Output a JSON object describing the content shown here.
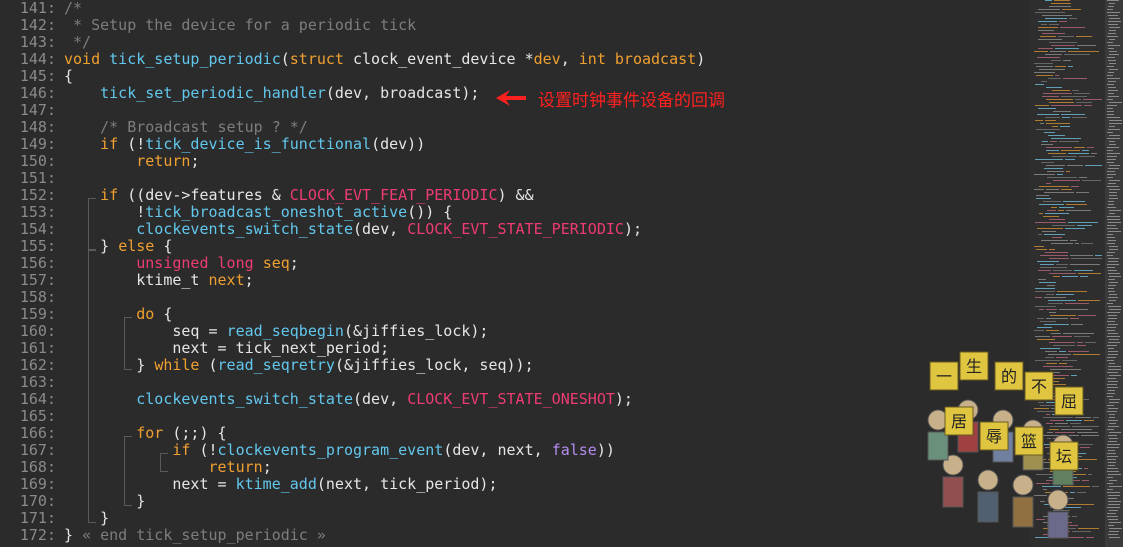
{
  "editor": {
    "lines": [
      {
        "n": "141:",
        "tokens": [
          [
            "cmt",
            "/*"
          ]
        ]
      },
      {
        "n": "142:",
        "tokens": [
          [
            "cmt",
            " * Setup the device for a periodic tick"
          ]
        ]
      },
      {
        "n": "143:",
        "tokens": [
          [
            "cmt",
            " */"
          ]
        ]
      },
      {
        "n": "144:",
        "tokens": [
          [
            "kw",
            "void"
          ],
          [
            "plain",
            " "
          ],
          [
            "fn",
            "tick_setup_periodic"
          ],
          [
            "plain",
            "("
          ],
          [
            "kw",
            "struct"
          ],
          [
            "plain",
            " clock_event_device *"
          ],
          [
            "param",
            "dev"
          ],
          [
            "plain",
            ", "
          ],
          [
            "kw",
            "int"
          ],
          [
            "plain",
            " "
          ],
          [
            "param",
            "broadcast"
          ],
          [
            "plain",
            ")"
          ]
        ]
      },
      {
        "n": "145:",
        "tokens": [
          [
            "plain",
            "{"
          ]
        ]
      },
      {
        "n": "146:",
        "tokens": [
          [
            "plain",
            "    "
          ],
          [
            "fn",
            "tick_set_periodic_handler"
          ],
          [
            "plain",
            "(dev, broadcast);"
          ]
        ]
      },
      {
        "n": "147:",
        "tokens": []
      },
      {
        "n": "148:",
        "tokens": [
          [
            "plain",
            "    "
          ],
          [
            "cmt",
            "/* Broadcast setup ? */"
          ]
        ]
      },
      {
        "n": "149:",
        "tokens": [
          [
            "plain",
            "    "
          ],
          [
            "kw",
            "if"
          ],
          [
            "plain",
            " (!"
          ],
          [
            "fn",
            "tick_device_is_functional"
          ],
          [
            "plain",
            "(dev))"
          ]
        ]
      },
      {
        "n": "150:",
        "tokens": [
          [
            "plain",
            "        "
          ],
          [
            "kw",
            "return"
          ],
          [
            "plain",
            ";"
          ]
        ]
      },
      {
        "n": "151:",
        "tokens": []
      },
      {
        "n": "152:",
        "tokens": [
          [
            "plain",
            "    "
          ],
          [
            "kw",
            "if"
          ],
          [
            "plain",
            " ((dev->features & "
          ],
          [
            "const",
            "CLOCK_EVT_FEAT_PERIODIC"
          ],
          [
            "plain",
            ") &&"
          ]
        ]
      },
      {
        "n": "153:",
        "tokens": [
          [
            "plain",
            "        !"
          ],
          [
            "fn",
            "tick_broadcast_oneshot_active"
          ],
          [
            "plain",
            "()) {"
          ]
        ]
      },
      {
        "n": "154:",
        "tokens": [
          [
            "plain",
            "        "
          ],
          [
            "fn",
            "clockevents_switch_state"
          ],
          [
            "plain",
            "(dev, "
          ],
          [
            "const",
            "CLOCK_EVT_STATE_PERIODIC"
          ],
          [
            "plain",
            ");"
          ]
        ]
      },
      {
        "n": "155:",
        "tokens": [
          [
            "plain",
            "    } "
          ],
          [
            "kw",
            "else"
          ],
          [
            "plain",
            " {"
          ]
        ]
      },
      {
        "n": "156:",
        "tokens": [
          [
            "plain",
            "        "
          ],
          [
            "const",
            "unsigned long"
          ],
          [
            "plain",
            " "
          ],
          [
            "kw",
            "seq"
          ],
          [
            "plain",
            ";"
          ]
        ]
      },
      {
        "n": "157:",
        "tokens": [
          [
            "plain",
            "        ktime_t "
          ],
          [
            "kw",
            "next"
          ],
          [
            "plain",
            ";"
          ]
        ]
      },
      {
        "n": "158:",
        "tokens": []
      },
      {
        "n": "159:",
        "tokens": [
          [
            "plain",
            "        "
          ],
          [
            "kw",
            "do"
          ],
          [
            "plain",
            " {"
          ]
        ]
      },
      {
        "n": "160:",
        "tokens": [
          [
            "plain",
            "            seq = "
          ],
          [
            "fn",
            "read_seqbegin"
          ],
          [
            "plain",
            "(&jiffies_lock);"
          ]
        ]
      },
      {
        "n": "161:",
        "tokens": [
          [
            "plain",
            "            next = tick_next_period;"
          ]
        ]
      },
      {
        "n": "162:",
        "tokens": [
          [
            "plain",
            "        } "
          ],
          [
            "kw",
            "while"
          ],
          [
            "plain",
            " ("
          ],
          [
            "fn",
            "read_seqretry"
          ],
          [
            "plain",
            "(&jiffies_lock, seq));"
          ]
        ]
      },
      {
        "n": "163:",
        "tokens": []
      },
      {
        "n": "164:",
        "tokens": [
          [
            "plain",
            "        "
          ],
          [
            "fn",
            "clockevents_switch_state"
          ],
          [
            "plain",
            "(dev, "
          ],
          [
            "const",
            "CLOCK_EVT_STATE_ONESHOT"
          ],
          [
            "plain",
            ");"
          ]
        ]
      },
      {
        "n": "165:",
        "tokens": []
      },
      {
        "n": "166:",
        "tokens": [
          [
            "plain",
            "        "
          ],
          [
            "kw",
            "for"
          ],
          [
            "plain",
            " (;;) {"
          ]
        ]
      },
      {
        "n": "167:",
        "tokens": [
          [
            "plain",
            "            "
          ],
          [
            "kw",
            "if"
          ],
          [
            "plain",
            " (!"
          ],
          [
            "fn",
            "clockevents_program_event"
          ],
          [
            "plain",
            "(dev, next, "
          ],
          [
            "bool",
            "false"
          ],
          [
            "plain",
            "))"
          ]
        ]
      },
      {
        "n": "168:",
        "tokens": [
          [
            "plain",
            "                "
          ],
          [
            "kw",
            "return"
          ],
          [
            "plain",
            ";"
          ]
        ]
      },
      {
        "n": "169:",
        "tokens": [
          [
            "plain",
            "            next = "
          ],
          [
            "fn",
            "ktime_add"
          ],
          [
            "plain",
            "(next, tick_period);"
          ]
        ]
      },
      {
        "n": "170:",
        "tokens": [
          [
            "plain",
            "        }"
          ]
        ]
      },
      {
        "n": "171:",
        "tokens": [
          [
            "plain",
            "    }"
          ]
        ]
      },
      {
        "n": "172:",
        "tokens": [
          [
            "plain",
            "} "
          ],
          [
            "cmt",
            "« end tick_setup_periodic »"
          ]
        ]
      }
    ]
  },
  "annotation": {
    "text": "设置时钟事件设备的回调",
    "arrow_icon": "arrow-left-icon",
    "color": "#ff2020"
  },
  "minimap": {
    "icon": "minimap-preview"
  },
  "watermark": {
    "characters": [
      "一",
      "生",
      "的",
      "不",
      "屈",
      "居",
      "辱",
      "篮",
      "坛"
    ]
  },
  "colors": {
    "background": "#2b2b2b",
    "keyword": "#f0a030",
    "function": "#62c7ec",
    "comment": "#7d7d7d",
    "constant": "#ee3b71",
    "boolean": "#b48cf0",
    "text": "#e6e6e6",
    "line_number": "#8a8a8a"
  }
}
